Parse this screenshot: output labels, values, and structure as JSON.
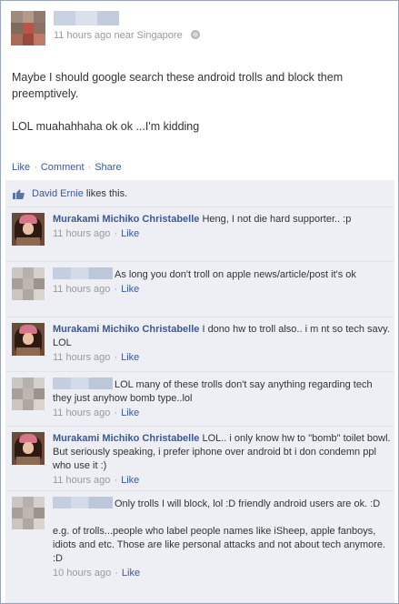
{
  "post": {
    "author_avatar_tiles": [
      "#9e8b7f",
      "#b59a87",
      "#8e7a70",
      "#7f6a5e",
      "#b8544a",
      "#8f6f63",
      "#aa6a58",
      "#9b4a3f",
      "#c07a65"
    ],
    "author_name_blur": [
      "#c9d1e2",
      "#dbe0ea",
      "#c3cbdd"
    ],
    "time": "11 hours ago",
    "location": "near Singapore",
    "text_1": "Maybe I should google search these android trolls and block them preemptively.",
    "text_2": "LOL muahahhaha ok ok ...I'm kidding"
  },
  "actions": {
    "like": "Like",
    "comment": "Comment",
    "share": "Share",
    "separator": "·"
  },
  "likes": {
    "person": "David Ernie",
    "suffix": "likes this."
  },
  "colors": {
    "link": "#3b5998",
    "meta": "#999999",
    "feedback_bg": "#edeff4",
    "border": "#9aa4bd"
  },
  "comments": [
    {
      "author": "Murakami Michiko Christabelle",
      "text": "Heng, I not die hard supporter.. :p",
      "time": "11 hours ago",
      "like": "Like",
      "avatar": "photo"
    },
    {
      "author": "",
      "text": "As long you don't troll on apple news/article/post it's ok",
      "time": "11 hours ago",
      "like": "Like",
      "avatar": "mosaic"
    },
    {
      "author": "Murakami Michiko Christabelle",
      "text": "I dono hw to troll also.. i m nt so tech savy. LOL",
      "time": "11 hours ago",
      "like": "Like",
      "avatar": "photo"
    },
    {
      "author": "",
      "text": "LOL many of these trolls don't say anything regarding tech they just anyhow bomb type..lol",
      "time": "11 hours ago",
      "like": "Like",
      "avatar": "mosaic"
    },
    {
      "author": "Murakami Michiko Christabelle",
      "text": "LOL.. i only know hw to \"bomb\" toilet bowl. But seriously speaking, i prefer iphone over android bt i don condemn ppl who use it :)",
      "time": "11 hours ago",
      "like": "Like",
      "avatar": "photo"
    },
    {
      "author": "",
      "text": "Only trolls I will block, lol :D friendly android users are ok. :D",
      "text_2": "e.g. of trolls...people who label people names like iSheep, apple fanboys, idiots and etc. Those are like personal attacks and not about tech anymore. :D",
      "time": "10 hours ago",
      "like": "Like",
      "avatar": "mosaic"
    }
  ]
}
